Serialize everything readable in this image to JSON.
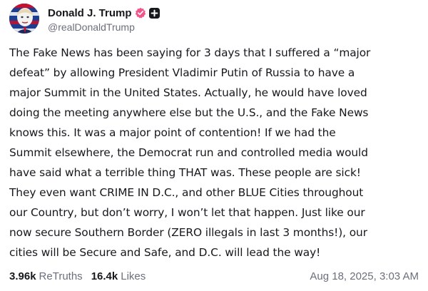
{
  "author": {
    "display_name": "Donald J. Trump",
    "handle": "@realDonaldTrump",
    "verified_icon": "verified-badge-icon",
    "extra_icon": "plus-badge-icon",
    "verified_color": "#f2558a"
  },
  "post": {
    "lines": [
      "The Fake News has been saying for 3 days that I suffered a “major",
      "defeat” by allowing President Vladimir Putin of Russia to have a",
      "major Summit in the United States. Actually, he would have loved",
      "doing the meeting anywhere else but the U.S., and the Fake News",
      "knows this. It was a major point of contention! If we had the",
      "Summit elsewhere, the Democrat run and controlled media would",
      "have said what a terrible thing THAT was. These people are sick!",
      "They even want CRIME IN D.C., and other BLUE Cities throughout",
      "our Country, but don’t worry, I won’t let that happen. Just like our",
      "now secure Southern Border (ZERO illegals in last 3 months!), our",
      "cities will be Secure and Safe, and D.C. will lead the way!"
    ]
  },
  "stats": {
    "retruths_count": "3.96k",
    "retruths_label": "ReTruths",
    "likes_count": "16.4k",
    "likes_label": "Likes"
  },
  "timestamp": "Aug 18, 2025, 3:03 AM"
}
